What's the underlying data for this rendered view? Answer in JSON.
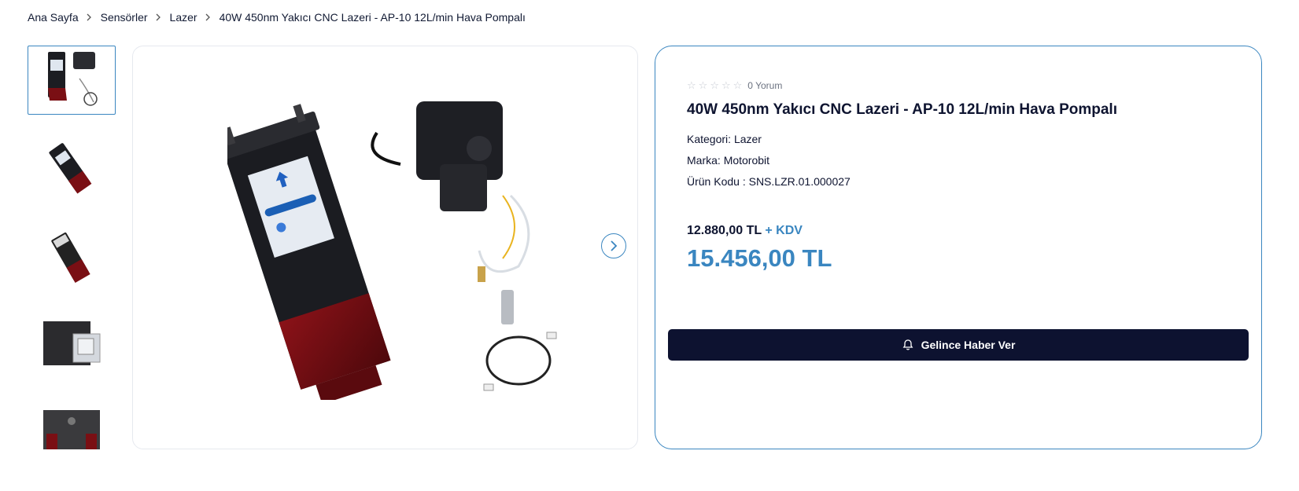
{
  "breadcrumb": {
    "items": [
      "Ana Sayfa",
      "Sensörler",
      "Lazer",
      "40W 450nm Yakıcı CNC Lazeri - AP-10 12L/min Hava Pompalı"
    ]
  },
  "gallery": {
    "thumbnails": [
      "product-full-set",
      "laser-module-angle",
      "laser-module-side",
      "laser-module-closeup",
      "laser-module-top"
    ],
    "active_index": 0
  },
  "product": {
    "rating_stars": 5,
    "rating_filled": 0,
    "review_count": "0 Yorum",
    "title": "40W 450nm Yakıcı CNC Lazeri - AP-10 12L/min Hava Pompalı",
    "category_label": "Kategori:",
    "category_value": "Lazer",
    "brand_label": "Marka:",
    "brand_value": "Motorobit",
    "code_label": "Ürün Kodu :",
    "code_value": "SNS.LZR.01.000027",
    "price_ex": "12.880,00 TL",
    "kdv_label": "+ KDV",
    "price_inc": "15.456,00 TL",
    "notify_label": "Gelince Haber Ver"
  },
  "colors": {
    "accent": "#3a86c0",
    "dark": "#0d1230",
    "laser_red": "#7a0f14"
  }
}
